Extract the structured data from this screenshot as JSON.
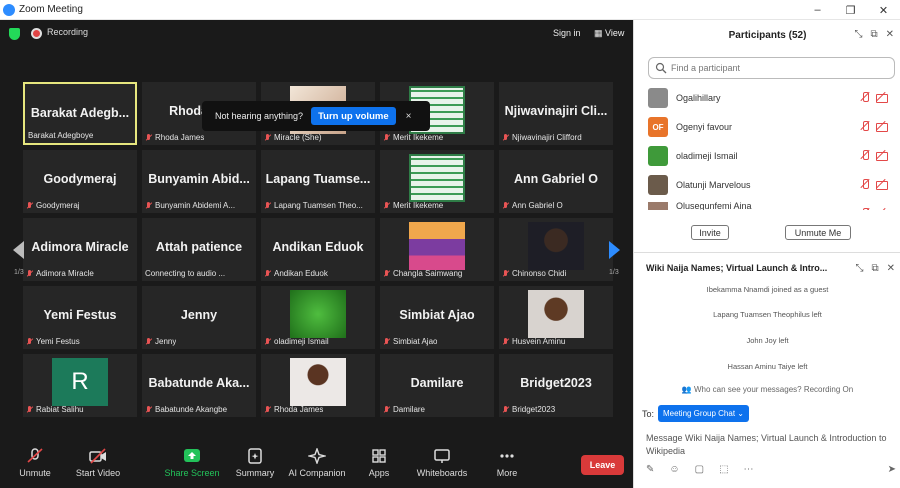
{
  "window": {
    "title": "Zoom Meeting",
    "controls": [
      "–",
      "❐",
      "✕"
    ]
  },
  "meeting": {
    "recording_label": "Recording",
    "sign_in": "Sign in",
    "view": "View",
    "toast": {
      "text": "Not hearing anything?",
      "button": "Turn up volume",
      "close": "×"
    },
    "page_left": "1/3",
    "page_right": "1/3",
    "tiles": [
      {
        "name": "Barakat Adegb...",
        "label": "Barakat Adegboye",
        "muted": false,
        "highlight": true
      },
      {
        "name": "Rhoda J...",
        "label": "Rhoda James",
        "muted": true
      },
      {
        "name": "",
        "label": "Miracle (She)",
        "muted": true,
        "photo": "poster"
      },
      {
        "name": "",
        "label": "Merit Ikekeme",
        "muted": true,
        "photo": "green-poster"
      },
      {
        "name": "Njiwavinajiri Cli...",
        "label": "Njiwavinajiri Clifford",
        "muted": true
      },
      {
        "name": "Goodymeraj",
        "label": "Goodymeraj",
        "muted": true
      },
      {
        "name": "Bunyamin Abid...",
        "label": "Bunyamin Abidemi A...",
        "muted": true
      },
      {
        "name": "Lapang Tuamse...",
        "label": "Lapang Tuamsen Theo...",
        "muted": true
      },
      {
        "name": "",
        "label": "Merit Ikekeme",
        "muted": true,
        "photo": "green-poster"
      },
      {
        "name": "Ann Gabriel O",
        "label": "Ann Gabriel O",
        "muted": true
      },
      {
        "name": "Adimora Miracle",
        "label": "Adimora Miracle",
        "muted": true
      },
      {
        "name": "Attah patience",
        "label": "Connecting to audio ...",
        "muted": false
      },
      {
        "name": "Andikan Eduok",
        "label": "Andikan Eduok",
        "muted": true
      },
      {
        "name": "",
        "label": "Changla Saimwang",
        "muted": true,
        "photo": "city"
      },
      {
        "name": "",
        "label": "Chinonso Chidi",
        "muted": true,
        "photo": "portrait"
      },
      {
        "name": "Yemi Festus",
        "label": "Yemi Festus",
        "muted": true
      },
      {
        "name": "Jenny",
        "label": "Jenny",
        "muted": true
      },
      {
        "name": "",
        "label": "oladimeji Ismail",
        "muted": true,
        "photo": "leaf"
      },
      {
        "name": "Simbiat Ajao",
        "label": "Simbiat Ajao",
        "muted": true
      },
      {
        "name": "",
        "label": "Husvein Aminu",
        "muted": true,
        "photo": "boy"
      },
      {
        "name": "",
        "label": "Rabiat Salihu",
        "muted": true,
        "photo": "initial",
        "initial": "R"
      },
      {
        "name": "Babatunde Aka...",
        "label": "Babatunde Akangbe",
        "muted": true
      },
      {
        "name": "",
        "label": "Rhoda James",
        "muted": true,
        "photo": "woman"
      },
      {
        "name": "Damilare",
        "label": "Damilare",
        "muted": true
      },
      {
        "name": "Bridget2023",
        "label": "Bridget2023",
        "muted": true
      }
    ],
    "toolbar": [
      {
        "label": "Unmute",
        "icon": "muted-mic-icon"
      },
      {
        "label": "Start Video",
        "icon": "video-off-icon"
      },
      {
        "label": "Share Screen",
        "icon": "share-screen-icon"
      },
      {
        "label": "Summary",
        "icon": "summary-icon"
      },
      {
        "label": "AI Companion",
        "icon": "ai-companion-icon"
      },
      {
        "label": "Apps",
        "icon": "apps-icon"
      },
      {
        "label": "Whiteboards",
        "icon": "whiteboard-icon"
      },
      {
        "label": "More",
        "icon": "more-icon"
      }
    ],
    "leave": "Leave"
  },
  "participants": {
    "title": "Participants (52)",
    "search_placeholder": "Find a participant",
    "list": [
      {
        "name": "Ogalihillary",
        "avatar_color": "#8a8a8a"
      },
      {
        "name": "Ogenyi favour",
        "avatar_color": "#e8742a",
        "initials": "OF"
      },
      {
        "name": "oladimeji Ismail",
        "avatar_color": "#3f9a3a"
      },
      {
        "name": "Olatunji Marvelous",
        "avatar_color": "#6b5b4b"
      },
      {
        "name": "Olusegunfemi Aina",
        "avatar_color": "#9a7a6a"
      }
    ],
    "invite": "Invite",
    "unmute_me": "Unmute Me"
  },
  "chat": {
    "title": "Wiki Naija Names; Virtual Launch & Intro...",
    "system_messages": [
      "Ibekamma Nnamdi joined as a guest",
      "Lapang Tuamsen Theophilus left",
      "John Joy left",
      "Hassan Aminu Taiye left"
    ],
    "who_can_see": "Who can see your messages? Recording On",
    "to_label": "To:",
    "recipient": "Meeting Group Chat",
    "message_placeholder": "Message Wiki Naija Names; Virtual Launch & Introduction to Wikipedia"
  }
}
